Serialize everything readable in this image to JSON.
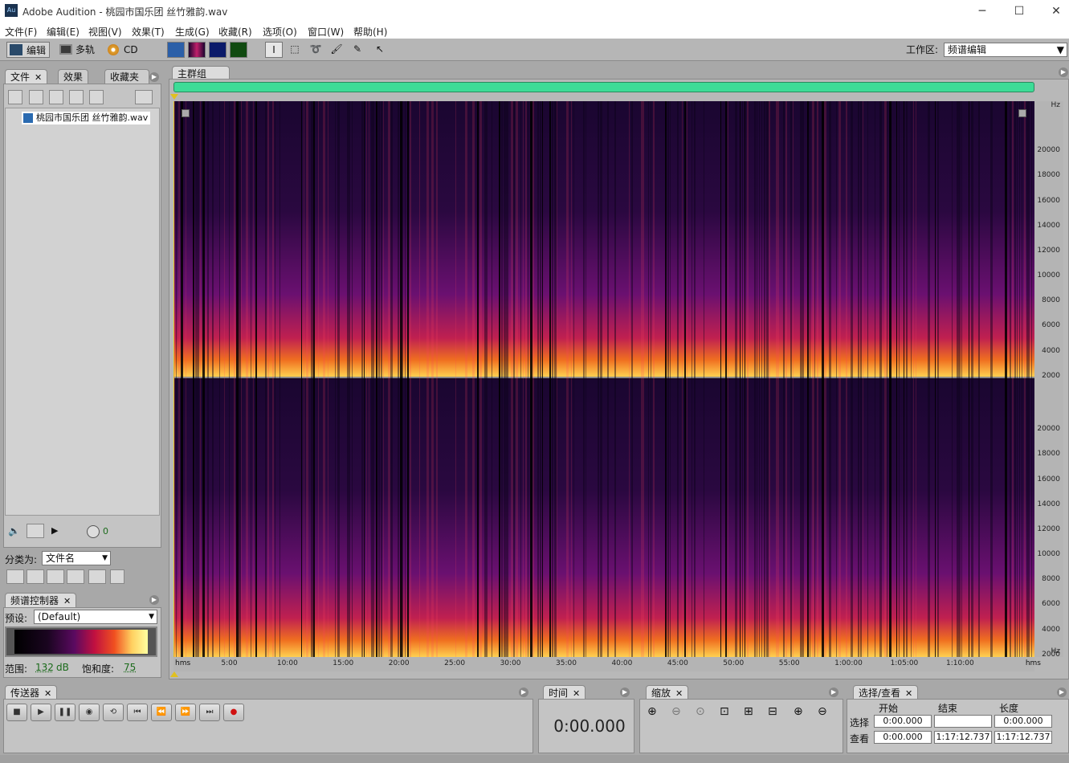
{
  "window": {
    "title": "Adobe Audition - 桃园市国乐团 丝竹雅韵.wav",
    "icon": "Au"
  },
  "menu": [
    "文件(F)",
    "编辑(E)",
    "视图(V)",
    "效果(T)",
    "生成(G)",
    "收藏(R)",
    "选项(O)",
    "窗口(W)",
    "帮助(H)"
  ],
  "toolbar": {
    "edit": "编辑",
    "multitrack": "多轨",
    "cd": "CD",
    "workspace_label": "工作区:",
    "workspace_value": "频谱编辑"
  },
  "files_panel": {
    "tabs": [
      "文件",
      "效果",
      "收藏夹"
    ],
    "file": "桃园市国乐团 丝竹雅韵.wav",
    "volume_value": "0",
    "sort_label": "分类为:",
    "sort_value": "文件名"
  },
  "spectral_panel": {
    "tab": "频谱控制器",
    "preset_label": "预设:",
    "preset_value": "(Default)",
    "range_label": "范围:",
    "range_value": "132",
    "range_unit": "dB",
    "saturation_label": "饱和度:",
    "saturation_value": "75"
  },
  "main": {
    "tab": "主群组",
    "hz_unit": "Hz",
    "hz_labels": [
      "20000",
      "18000",
      "16000",
      "14000",
      "12000",
      "10000",
      "8000",
      "6000",
      "4000",
      "2000"
    ],
    "time_unit": "hms",
    "time_labels": [
      "5:00",
      "10:00",
      "15:00",
      "20:00",
      "25:00",
      "30:00",
      "35:00",
      "40:00",
      "45:00",
      "50:00",
      "55:00",
      "1:00:00",
      "1:05:00",
      "1:10:00"
    ]
  },
  "transport": {
    "tab": "传送器"
  },
  "time_panel": {
    "tab": "时间",
    "value": "0:00.000"
  },
  "zoom_panel": {
    "tab": "缩放"
  },
  "selection_panel": {
    "tab": "选择/查看",
    "col_start": "开始",
    "col_end": "结束",
    "col_length": "长度",
    "row_select": "选择",
    "row_view": "查看",
    "select_start": "0:00.000",
    "select_end": "",
    "select_length": "0:00.000",
    "view_start": "0:00.000",
    "view_end": "1:17:12.737",
    "view_length": "1:17:12.737"
  },
  "colors": {
    "accent_green": "#3ddc97",
    "spectrum_dark": "#12041e",
    "spectrum_hot": "#ffe060"
  }
}
